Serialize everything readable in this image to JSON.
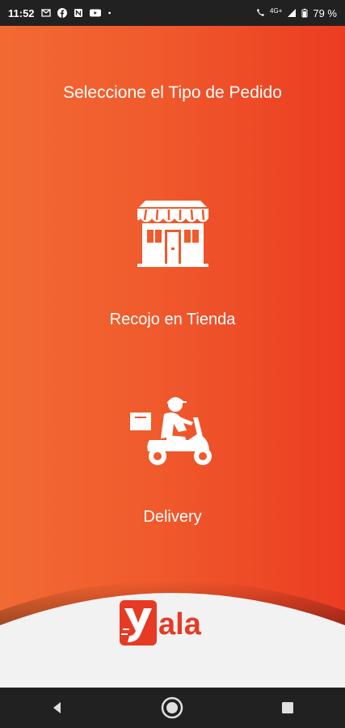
{
  "status_bar": {
    "time": "11:52",
    "notification_icons": [
      "gmail-icon",
      "facebook-icon",
      "news-icon",
      "youtube-icon",
      "dot-icon"
    ],
    "network": "4G+",
    "battery": "79 %"
  },
  "page": {
    "title": "Seleccione el Tipo de Pedido"
  },
  "options": [
    {
      "label": "Recojo en Tienda",
      "icon": "store-icon"
    },
    {
      "label": "Delivery",
      "icon": "delivery-scooter-icon"
    }
  ],
  "brand": {
    "logo_text": "yala",
    "primary_color": "#f05a2c",
    "accent_color": "#e63a24"
  },
  "nav_bar": {
    "buttons": [
      "back-icon",
      "home-icon",
      "recents-icon"
    ]
  }
}
